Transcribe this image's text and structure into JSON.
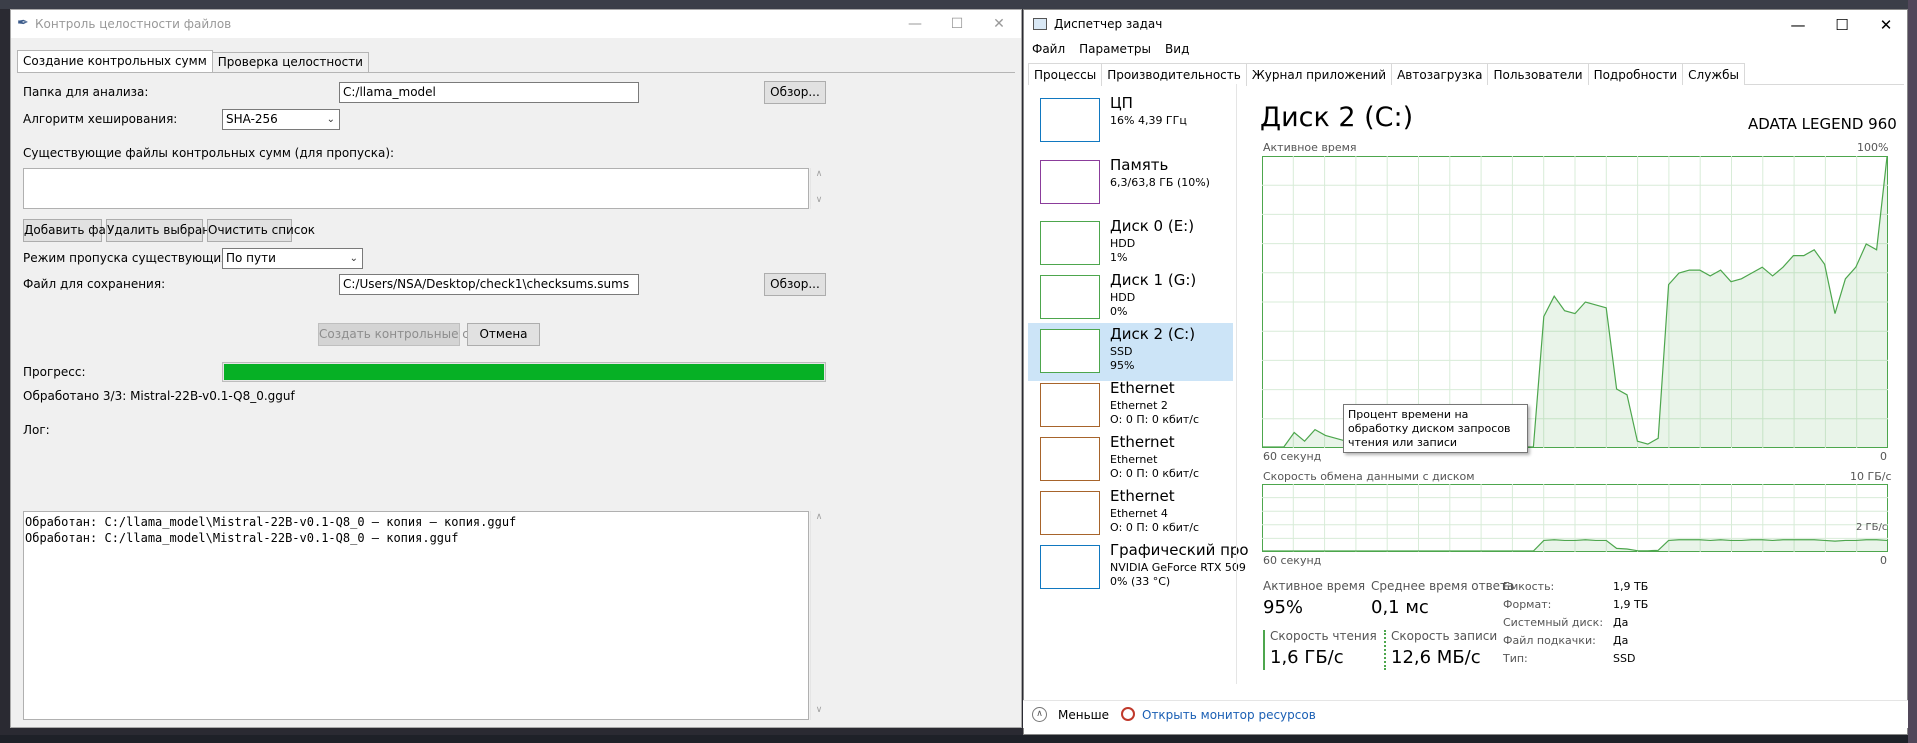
{
  "left_window": {
    "title": "Контроль целостности файлов",
    "controls": {
      "minimize": "—",
      "maximize": "☐",
      "close": "✕"
    },
    "tabs": [
      "Создание контрольных сумм",
      "Проверка целостности"
    ],
    "folder_label": "Папка для анализа:",
    "folder_value": "C:/llama_model",
    "browse_label": "Обзор...",
    "algo_label": "Алгоритм хеширования:",
    "algo_value": "SHA-256",
    "existing_label": "Существующие файлы контрольных сумм (для пропуска):",
    "add_file": "Добавить файл",
    "remove_selected": "Удалить выбранный",
    "clear_list": "Очистить список",
    "skip_mode_label": "Режим пропуска существующих файлов:",
    "skip_mode_value": "По пути",
    "save_label": "Файл для сохранения:",
    "save_value": "C:/Users/NSA/Desktop/check1\\checksums.sums",
    "browse2_label": "Обзор...",
    "create_button": "Создать контрольные суммы",
    "cancel_button": "Отмена",
    "progress_label": "Прогресс:",
    "progress_value": 1.0,
    "processed_text": "Обработано 3/3: Mistral-22B-v0.1-Q8_0.gguf",
    "log_label": "Лог:",
    "log_lines": [
      "Обработан: C:/llama_model\\Mistral-22B-v0.1-Q8_0 — копия — копия.gguf",
      "Обработан: C:/llama_model\\Mistral-22B-v0.1-Q8_0 — копия.gguf"
    ]
  },
  "task_manager": {
    "title": "Диспетчер задач",
    "menu": [
      "Файл",
      "Параметры",
      "Вид"
    ],
    "tabs": [
      "Процессы",
      "Производительность",
      "Журнал приложений",
      "Автозагрузка",
      "Пользователи",
      "Подробности",
      "Службы"
    ],
    "sidebar": [
      {
        "name": "ЦП",
        "sub1": "16% 4,39 ГГц",
        "sub2": "",
        "sub3": "",
        "color": "#1178c0"
      },
      {
        "name": "Память",
        "sub1": "6,3/63,8 ГБ (10%)",
        "sub2": "",
        "sub3": "",
        "color": "#8b3d9b"
      },
      {
        "name": "Диск 0 (E:)",
        "sub1": "HDD",
        "sub2": "1%",
        "sub3": "",
        "color": "#4da64d"
      },
      {
        "name": "Диск 1 (G:)",
        "sub1": "HDD",
        "sub2": "0%",
        "sub3": "",
        "color": "#4da64d"
      },
      {
        "name": "Диск 2 (C:)",
        "sub1": "SSD",
        "sub2": "95%",
        "sub3": "",
        "color": "#4da64d"
      },
      {
        "name": "Ethernet",
        "sub1": "Ethernet 2",
        "sub2": "О: 0 П: 0 кбит/с",
        "sub3": "",
        "color": "#a7642b"
      },
      {
        "name": "Ethernet",
        "sub1": "Ethernet",
        "sub2": "О: 0 П: 0 кбит/с",
        "sub3": "",
        "color": "#a7642b"
      },
      {
        "name": "Ethernet",
        "sub1": "Ethernet 4",
        "sub2": "О: 0 П: 0 кбит/с",
        "sub3": "",
        "color": "#a7642b"
      },
      {
        "name": "Графический про",
        "sub1": "NVIDIA GeForce RTX 509",
        "sub2": "0% (33 °C)",
        "sub3": "",
        "color": "#1178c0"
      }
    ],
    "main_title": "Диск 2 (C:)",
    "model": "ADATA LEGEND 960",
    "graph1_label": "Активное время",
    "graph1_max": "100%",
    "graph1_left": "60 секунд",
    "graph1_right": "0",
    "graph2_label": "Скорость обмена данными с диском",
    "graph2_max": "10 ГБ/с",
    "graph2_mid": "2 ГБ/с",
    "graph2_left": "60 секунд",
    "graph2_right": "0",
    "tooltip": "Процент времени на обработку диском запросов чтения или записи",
    "stats": {
      "active_label": "Активное время",
      "active_value": "95%",
      "resp_label": "Среднее время ответа",
      "resp_value": "0,1 мс",
      "read_label": "Скорость чтения",
      "read_value": "1,6 ГБ/с",
      "write_label": "Скорость записи",
      "write_value": "12,6 МБ/с"
    },
    "props": [
      {
        "k": "Емкость:",
        "v": "1,9 ТБ"
      },
      {
        "k": "Формат:",
        "v": "1,9 ТБ"
      },
      {
        "k": "Системный диск:",
        "v": "Да"
      },
      {
        "k": "Файл подкачки:",
        "v": "Да"
      },
      {
        "k": "Тип:",
        "v": "SSD"
      }
    ],
    "footer_less": "Меньше",
    "footer_monitor": "Открыть монитор ресурсов",
    "graph_color": "#4da64d"
  },
  "chart_data": [
    {
      "type": "area",
      "title": "Активное время",
      "xlabel": "60 секунд",
      "ylabel": "",
      "ylim": [
        0,
        100
      ],
      "x": [
        0,
        1,
        2,
        3,
        4,
        5,
        6,
        7,
        8,
        9,
        10,
        11,
        12,
        13,
        14,
        15,
        16,
        17,
        18,
        19,
        20,
        21,
        22,
        23,
        24,
        25,
        26,
        27,
        28,
        29,
        30,
        31,
        32,
        33,
        34,
        35,
        36,
        37,
        38,
        39,
        40,
        41,
        42,
        43,
        44,
        45,
        46,
        47,
        48,
        49,
        50,
        51,
        52,
        53,
        54,
        55,
        56,
        57,
        58,
        59,
        60
      ],
      "values": [
        0,
        0,
        0,
        5,
        2,
        6,
        4,
        3,
        2,
        0,
        0,
        0,
        0,
        0,
        0,
        0,
        0,
        0,
        0,
        0,
        0,
        0,
        0,
        0,
        0,
        0,
        0,
        45,
        52,
        47,
        46,
        50,
        49,
        48,
        20,
        18,
        2,
        1,
        3,
        56,
        60,
        61,
        61,
        59,
        61,
        57,
        58,
        60,
        62,
        59,
        62,
        66,
        66,
        68,
        63,
        46,
        58,
        62,
        70,
        68,
        100
      ]
    },
    {
      "type": "line",
      "title": "Скорость обмена данными с диском",
      "xlabel": "60 секунд",
      "ylabel": "",
      "ylim": [
        0,
        10
      ],
      "x": [
        0,
        1,
        2,
        3,
        4,
        5,
        6,
        7,
        8,
        9,
        10,
        11,
        12,
        13,
        14,
        15,
        16,
        17,
        18,
        19,
        20,
        21,
        22,
        23,
        24,
        25,
        26,
        27,
        28,
        29,
        30,
        31,
        32,
        33,
        34,
        35,
        36,
        37,
        38,
        39,
        40,
        41,
        42,
        43,
        44,
        45,
        46,
        47,
        48,
        49,
        50,
        51,
        52,
        53,
        54,
        55,
        56,
        57,
        58,
        59,
        60
      ],
      "values": [
        0,
        0,
        0,
        0,
        0,
        0,
        0,
        0,
        0,
        0,
        0,
        0,
        0,
        0,
        0,
        0,
        0,
        0,
        0,
        0,
        0,
        0,
        0,
        0,
        0,
        0,
        0,
        1.6,
        1.7,
        1.6,
        1.6,
        1.7,
        1.6,
        1.6,
        0.4,
        0.3,
        0.05,
        0.03,
        0.1,
        1.6,
        1.7,
        1.7,
        1.7,
        1.6,
        1.7,
        1.6,
        1.6,
        1.7,
        1.7,
        1.6,
        1.7,
        1.7,
        1.7,
        1.7,
        1.6,
        1.5,
        1.6,
        1.6,
        1.7,
        1.7,
        1.6
      ]
    }
  ]
}
